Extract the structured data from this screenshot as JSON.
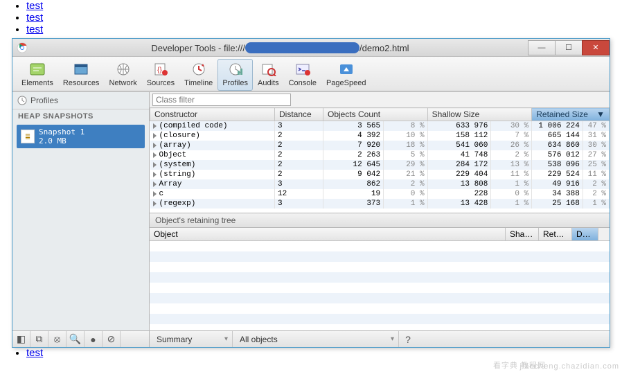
{
  "bg_links": [
    "test",
    "test",
    "test",
    "test"
  ],
  "window": {
    "title_prefix": "Developer Tools - file:///",
    "title_suffix": "/demo2.html"
  },
  "panels": [
    {
      "id": "elements",
      "label": "Elements"
    },
    {
      "id": "resources",
      "label": "Resources"
    },
    {
      "id": "network",
      "label": "Network"
    },
    {
      "id": "sources",
      "label": "Sources"
    },
    {
      "id": "timeline",
      "label": "Timeline"
    },
    {
      "id": "profiles",
      "label": "Profiles",
      "active": true
    },
    {
      "id": "audits",
      "label": "Audits"
    },
    {
      "id": "console",
      "label": "Console"
    },
    {
      "id": "pagespeed",
      "label": "PageSpeed"
    }
  ],
  "sidebar": {
    "title": "Profiles",
    "category": "HEAP SNAPSHOTS",
    "snapshot": {
      "name": "Snapshot 1",
      "size": "2.0 MB"
    }
  },
  "filter_placeholder": "Class filter",
  "columns": {
    "constructor": "Constructor",
    "distance": "Distance",
    "objcount": "Objects Count",
    "shallow": "Shallow Size",
    "retained": "Retained Size"
  },
  "rows": [
    {
      "ctor": "(compiled code)",
      "dist": "3",
      "oc": "3 565",
      "ocp": "8 %",
      "sh": "633 976",
      "shp": "30 %",
      "rt": "1 006 224",
      "rtp": "47 %"
    },
    {
      "ctor": "(closure)",
      "dist": "2",
      "oc": "4 392",
      "ocp": "10 %",
      "sh": "158 112",
      "shp": "7 %",
      "rt": "665 144",
      "rtp": "31 %"
    },
    {
      "ctor": "(array)",
      "dist": "2",
      "oc": "7 920",
      "ocp": "18 %",
      "sh": "541 060",
      "shp": "26 %",
      "rt": "634 860",
      "rtp": "30 %"
    },
    {
      "ctor": "Object",
      "dist": "2",
      "oc": "2 263",
      "ocp": "5 %",
      "sh": "41 748",
      "shp": "2 %",
      "rt": "576 012",
      "rtp": "27 %"
    },
    {
      "ctor": "(system)",
      "dist": "2",
      "oc": "12 645",
      "ocp": "29 %",
      "sh": "284 172",
      "shp": "13 %",
      "rt": "538 096",
      "rtp": "25 %"
    },
    {
      "ctor": "(string)",
      "dist": "2",
      "oc": "9 042",
      "ocp": "21 %",
      "sh": "229 404",
      "shp": "11 %",
      "rt": "229 524",
      "rtp": "11 %"
    },
    {
      "ctor": "Array",
      "dist": "3",
      "oc": "862",
      "ocp": "2 %",
      "sh": "13 808",
      "shp": "1 %",
      "rt": "49 916",
      "rtp": "2 %"
    },
    {
      "ctor": "c",
      "dist": "12",
      "oc": "19",
      "ocp": "0 %",
      "sh": "228",
      "shp": "0 %",
      "rt": "34 388",
      "rtp": "2 %"
    },
    {
      "ctor": "(regexp)",
      "dist": "3",
      "oc": "373",
      "ocp": "1 %",
      "sh": "13 428",
      "shp": "1 %",
      "rt": "25 168",
      "rtp": "1 %"
    }
  ],
  "retain": {
    "title": "Object's retaining tree",
    "cols": {
      "object": "Object",
      "shallow": "Shal…",
      "retained": "Ret…",
      "distance": "D…"
    }
  },
  "status": {
    "view": "Summary",
    "filter": "All objects"
  },
  "watermark1": "看字典 教程网",
  "watermark2": "jiaocheng.chazidian.com"
}
